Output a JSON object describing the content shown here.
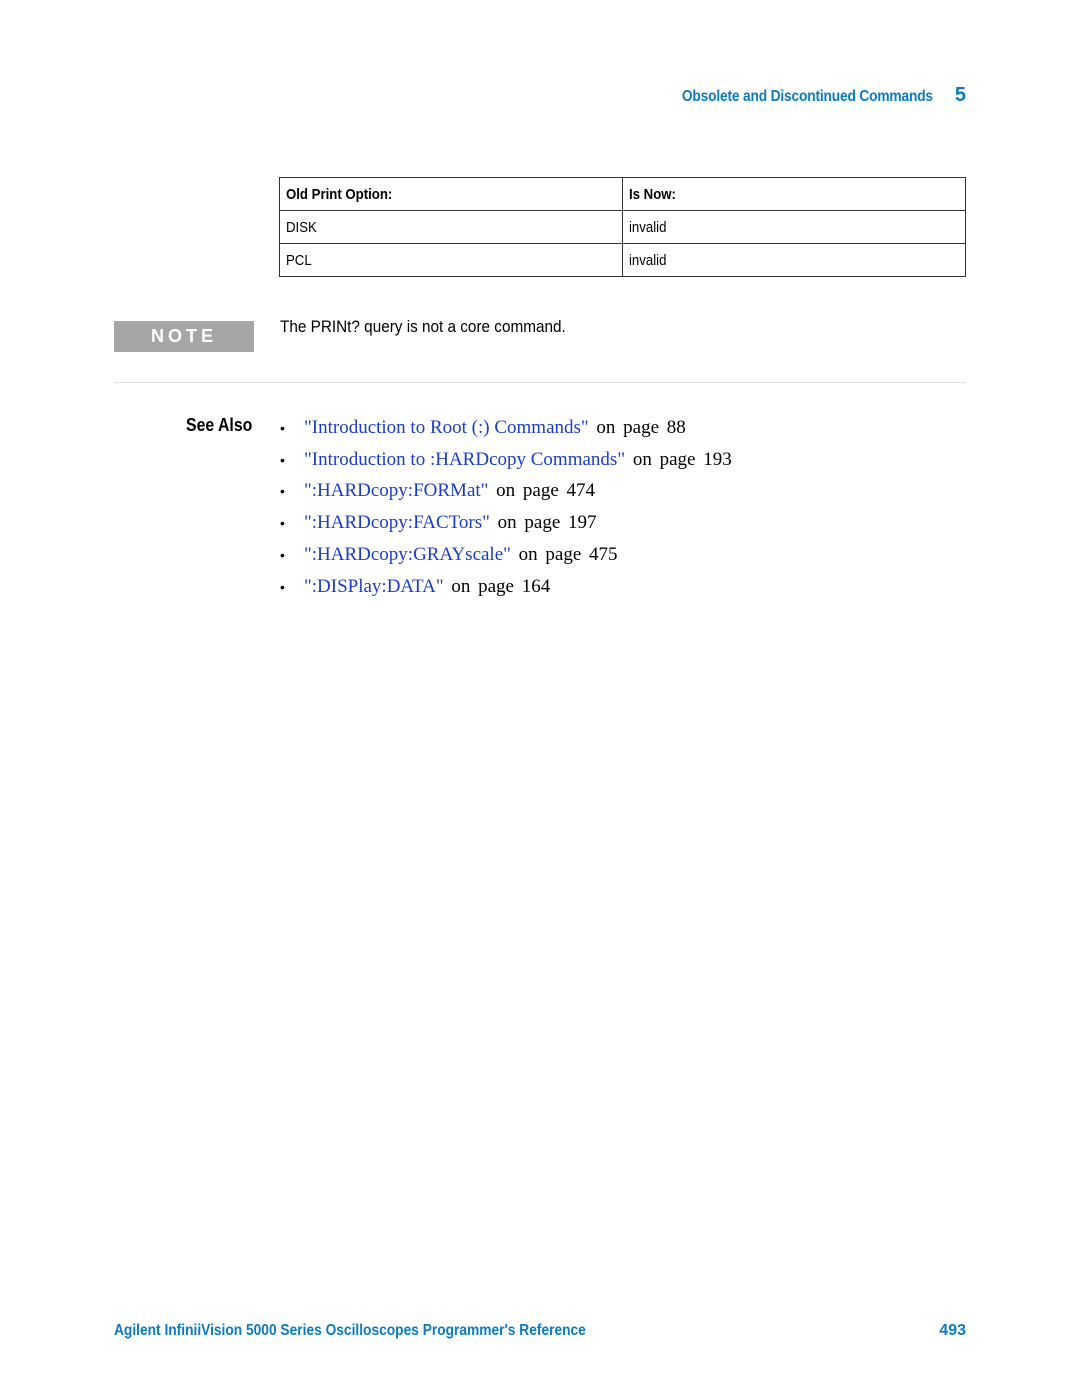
{
  "header": {
    "section_title": "Obsolete and Discontinued Commands",
    "chapter_number": "5"
  },
  "table": {
    "columns": [
      "Old Print Option:",
      "Is Now:"
    ],
    "rows": [
      [
        "DISK",
        "invalid"
      ],
      [
        "PCL",
        "invalid"
      ]
    ]
  },
  "note": {
    "label": "NOTE",
    "text": "The PRINt? query is not a core command."
  },
  "see_also": {
    "label": "See Also",
    "items": [
      {
        "link": "\"Introduction to Root (:) Commands\"",
        "ref": " on page 88"
      },
      {
        "link": "\"Introduction to :HARDcopy Commands\"",
        "ref": " on page 193"
      },
      {
        "link": "\":HARDcopy:FORMat\"",
        "ref": " on page 474"
      },
      {
        "link": "\":HARDcopy:FACTors\"",
        "ref": " on page 197"
      },
      {
        "link": "\":HARDcopy:GRAYscale\"",
        "ref": " on page 475"
      },
      {
        "link": "\":DISPlay:DATA\"",
        "ref": " on page 164"
      }
    ]
  },
  "footer": {
    "title": "Agilent InfiniiVision 5000 Series Oscilloscopes Programmer's Reference",
    "page_number": "493"
  },
  "colors": {
    "accent_blue": "#0a7ac4",
    "link_blue": "#1a3cc8",
    "note_gray": "#a6a6a6"
  }
}
